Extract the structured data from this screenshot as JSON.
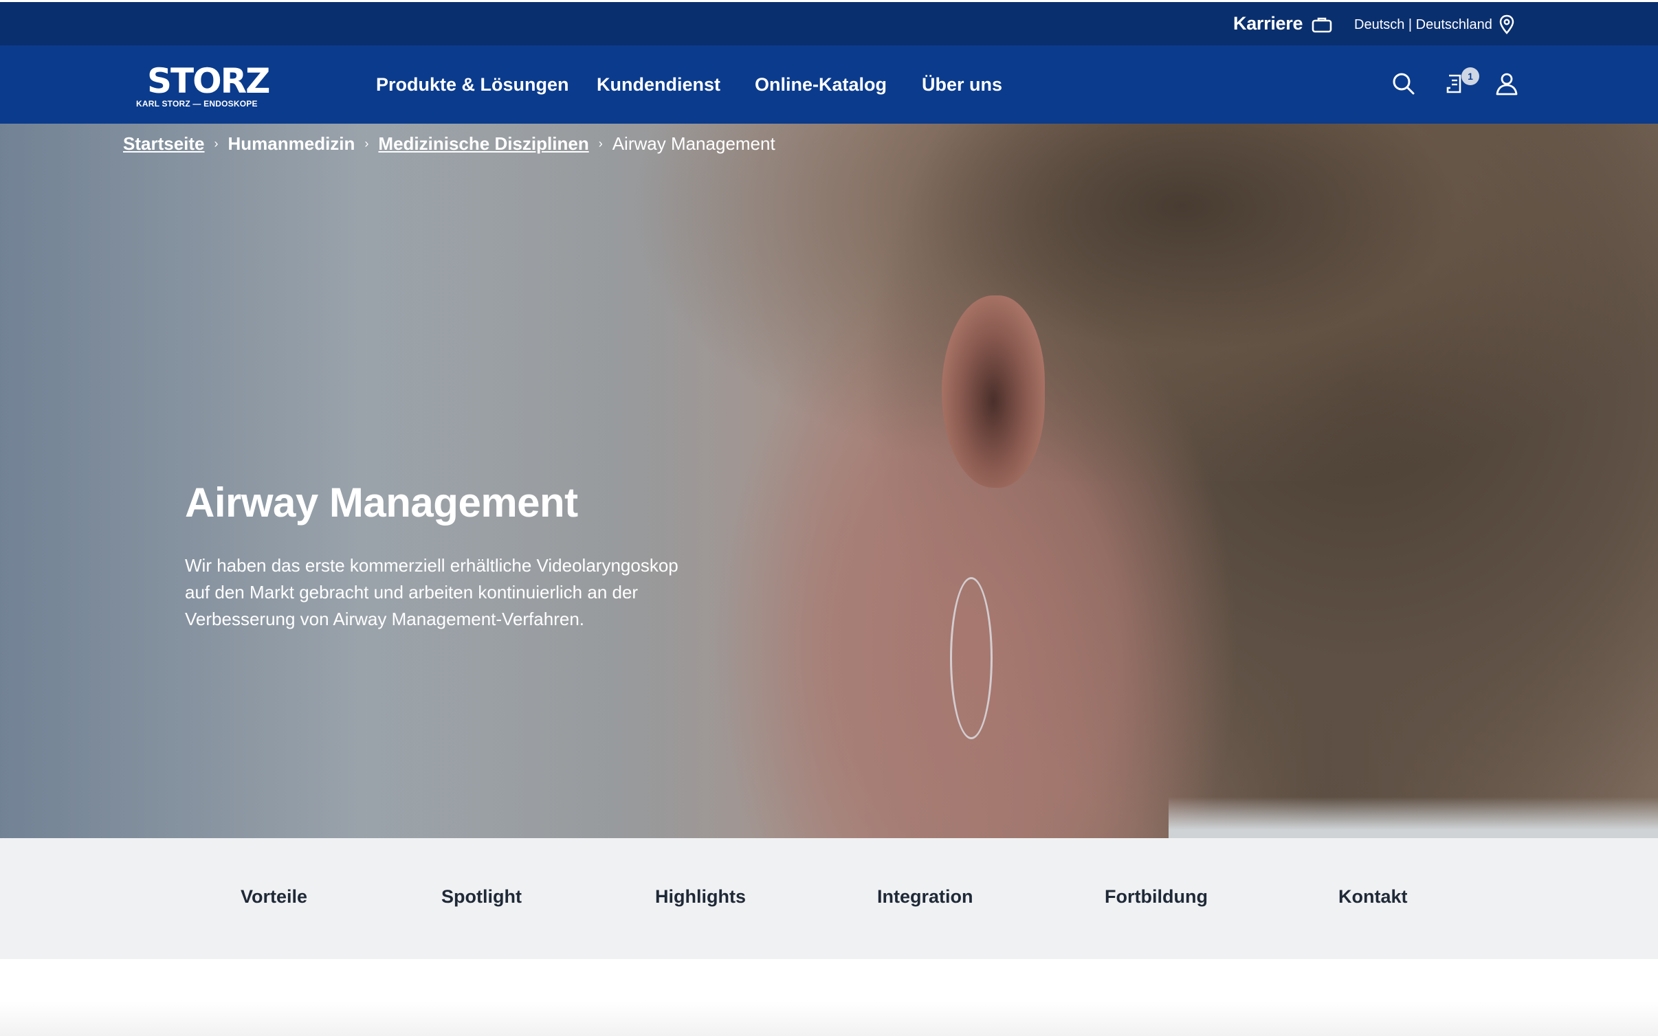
{
  "topbar": {
    "career_label": "Karriere",
    "language_region": "Deutsch | Deutschland"
  },
  "brand": {
    "logo_word": "STORZ",
    "logo_sub": "KARL STORZ — ENDOSKOPE"
  },
  "nav": {
    "items": [
      {
        "label": "Produkte & Lösungen"
      },
      {
        "label": "Kundendienst"
      },
      {
        "label": "Online-Katalog"
      },
      {
        "label": "Über uns"
      }
    ],
    "cart_count": "1"
  },
  "breadcrumb": {
    "items": [
      {
        "label": "Startseite"
      },
      {
        "label": "Humanmedizin"
      },
      {
        "label": "Medizinische Disziplinen"
      },
      {
        "label": "Airway Management"
      }
    ]
  },
  "hero": {
    "title": "Airway Management",
    "text": "Wir haben das erste kommerziell erhältliche Videolaryngoskop auf den Markt gebracht und arbeiten kontinuierlich an der Verbesserung von Airway Management-Verfahren."
  },
  "subnav": {
    "tabs": [
      {
        "label": "Vorteile"
      },
      {
        "label": "Spotlight"
      },
      {
        "label": "Highlights"
      },
      {
        "label": "Integration"
      },
      {
        "label": "Fortbildung"
      },
      {
        "label": "Kontakt"
      }
    ]
  },
  "colors": {
    "topbar": "#0a2f6e",
    "mainnav": "#0b3b8c",
    "subnav_bg": "#f0f1f3"
  }
}
